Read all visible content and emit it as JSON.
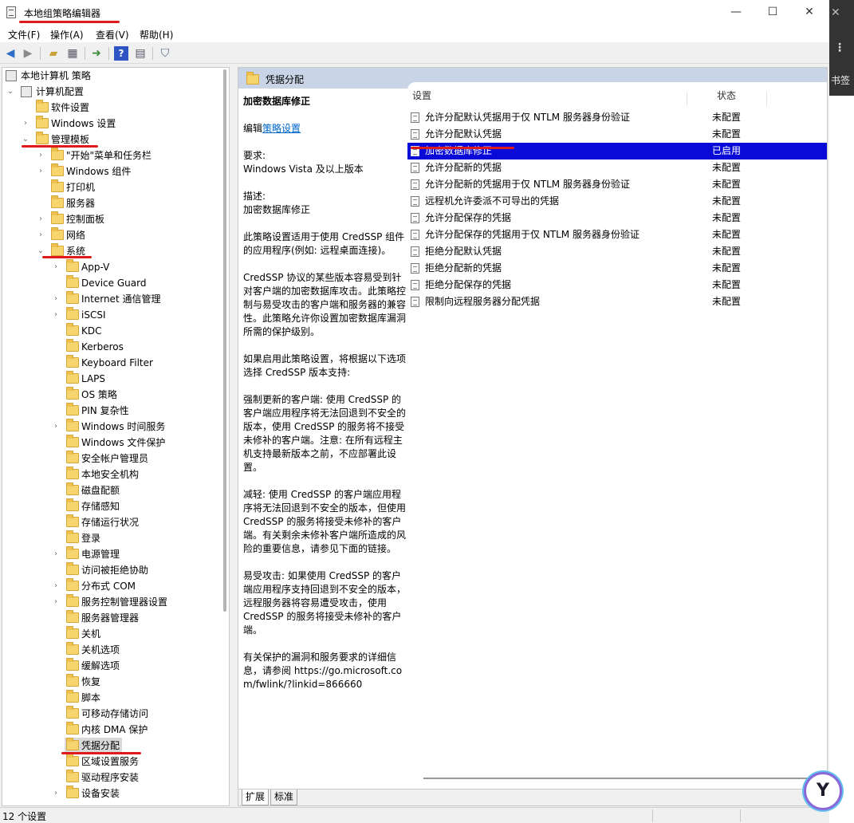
{
  "window": {
    "title": "本地组策略编辑器",
    "controls": {
      "minimize": "—",
      "maximize": "☐",
      "close": "✕"
    }
  },
  "menu": [
    {
      "label": "文件(F)"
    },
    {
      "label": "操作(A)"
    },
    {
      "label": "查看(V)"
    },
    {
      "label": "帮助(H)"
    }
  ],
  "toolbar": {
    "buttons": [
      "back-icon",
      "forward-icon",
      "up-folder-icon",
      "show-hide-tree-icon",
      "export-list-icon",
      "help-icon",
      "properties-icon",
      "filter-icon"
    ]
  },
  "tree": {
    "root": "本地计算机 策略",
    "computer_config": "计算机配置",
    "software_settings": "软件设置",
    "windows_settings": "Windows 设置",
    "admin_templates": "管理模板",
    "start_menu": "\"开始\"菜单和任务栏",
    "windows_components": "Windows 组件",
    "printers": "打印机",
    "servers": "服务器",
    "control_panel": "控制面板",
    "network": "网络",
    "system": "系统",
    "system_children": [
      "App-V",
      "Device Guard",
      "Internet 通信管理",
      "iSCSI",
      "KDC",
      "Kerberos",
      "Keyboard Filter",
      "LAPS",
      "OS 策略",
      "PIN 复杂性",
      "Windows 时间服务",
      "Windows 文件保护",
      "安全帐户管理员",
      "本地安全机构",
      "磁盘配额",
      "存储感知",
      "存储运行状况",
      "登录",
      "电源管理",
      "访问被拒绝协助",
      "分布式 COM",
      "服务控制管理器设置",
      "服务器管理器",
      "关机",
      "关机选项",
      "缓解选项",
      "恢复",
      "脚本",
      "可移动存储访问",
      "内核 DMA 保护",
      "凭据分配",
      "区域设置服务",
      "驱动程序安装",
      "设备安装"
    ]
  },
  "detail": {
    "header": "凭据分配",
    "policy_title": "加密数据库修正",
    "edit_prefix": "编辑",
    "edit_link": "策略设置",
    "requirements_label": "要求:",
    "requirements_value": "Windows Vista 及以上版本",
    "description_label": "描述:",
    "description_value": "加密数据库修正",
    "para1": "此策略设置适用于使用 CredSSP 组件的应用程序(例如: 远程桌面连接)。",
    "para2": "CredSSP 协议的某些版本容易受到针对客户端的加密数据库攻击。此策略控制与易受攻击的客户端和服务器的兼容性。此策略允许你设置加密数据库漏洞所需的保护级别。",
    "para3": "如果启用此策略设置，将根据以下选项选择 CredSSP 版本支持:",
    "para4": "强制更新的客户端: 使用 CredSSP 的客户端应用程序将无法回退到不安全的版本，使用 CredSSP 的服务将不接受未修补的客户端。注意: 在所有远程主机支持最新版本之前，不应部署此设置。",
    "para5": "减轻: 使用 CredSSP 的客户端应用程序将无法回退到不安全的版本，但使用 CredSSP 的服务将接受未修补的客户端。有关剩余未修补客户端所造成的风险的重要信息，请参见下面的链接。",
    "para6": "易受攻击: 如果使用 CredSSP 的客户端应用程序支持回退到不安全的版本，远程服务器将容易遭受攻击，使用 CredSSP 的服务将接受未修补的客户端。",
    "para7": "有关保护的漏洞和服务要求的详细信息，请参阅 https://go.microsoft.com/fwlink/?linkid=866660"
  },
  "list": {
    "col_setting": "设置",
    "col_state": "状态",
    "rows": [
      {
        "name": "允许分配默认凭据用于仅 NTLM 服务器身份验证",
        "state": "未配置"
      },
      {
        "name": "允许分配默认凭据",
        "state": "未配置"
      },
      {
        "name": "加密数据库修正",
        "state": "已启用"
      },
      {
        "name": "允许分配新的凭据",
        "state": "未配置"
      },
      {
        "name": "允许分配新的凭据用于仅 NTLM 服务器身份验证",
        "state": "未配置"
      },
      {
        "name": "远程机允许委派不可导出的凭据",
        "state": "未配置"
      },
      {
        "name": "允许分配保存的凭据",
        "state": "未配置"
      },
      {
        "name": "允许分配保存的凭据用于仅 NTLM 服务器身份验证",
        "state": "未配置"
      },
      {
        "name": "拒绝分配默认凭据",
        "state": "未配置"
      },
      {
        "name": "拒绝分配新的凭据",
        "state": "未配置"
      },
      {
        "name": "拒绝分配保存的凭据",
        "state": "未配置"
      },
      {
        "name": "限制向远程服务器分配凭据",
        "state": "未配置"
      }
    ],
    "selected_index": 2
  },
  "tabs": {
    "extended": "扩展",
    "standard": "标准"
  },
  "status": {
    "count": "12 个设置"
  },
  "side": {
    "bookmark": "书签"
  },
  "colors": {
    "selection": "#0a0ad8",
    "header": "#c9d5e6",
    "annotation": "#e0191c"
  }
}
